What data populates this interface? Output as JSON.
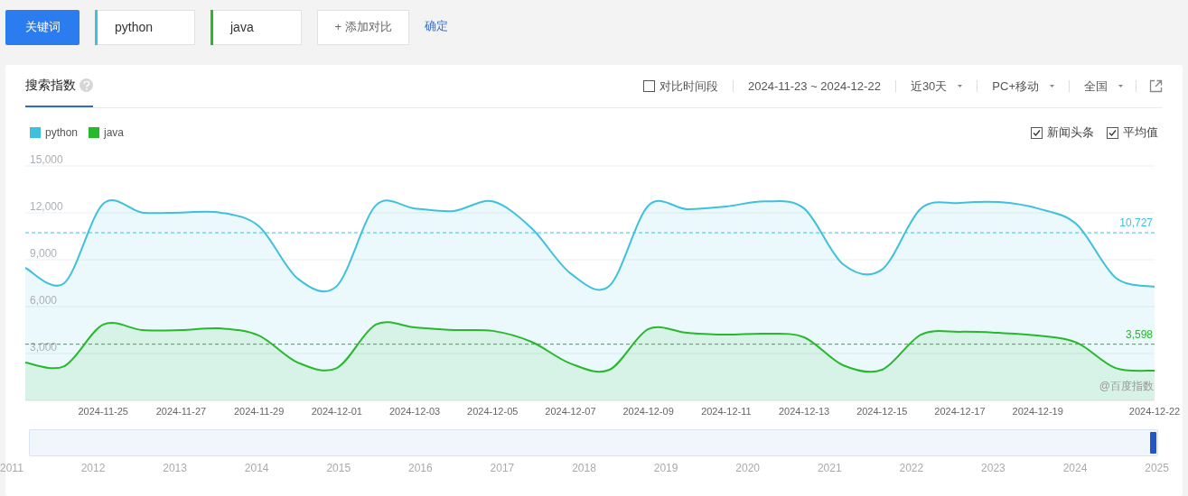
{
  "top_bar": {
    "type_button": "关键词",
    "keywords": [
      {
        "text": "python",
        "color": "#3fc0dd"
      },
      {
        "text": "java",
        "color": "#28b82c"
      }
    ],
    "add_button": "+ 添加对比",
    "confirm_link": "确定"
  },
  "panel": {
    "tabs": [
      {
        "label": "搜索指数",
        "selected": true
      }
    ],
    "compare_period": {
      "label": "对比时间段",
      "checked": false
    },
    "date_range": "2024-11-23 ~ 2024-12-22",
    "dropdowns": [
      {
        "label": "近30天"
      },
      {
        "label": "PC+移动"
      },
      {
        "label": "全国"
      }
    ],
    "options": [
      {
        "label": "新闻头条",
        "checked": true
      },
      {
        "label": "平均值",
        "checked": true
      }
    ],
    "chart_data": {
      "type": "area",
      "x": [
        "2024-11-23",
        "2024-11-24",
        "2024-11-25",
        "2024-11-26",
        "2024-11-27",
        "2024-11-28",
        "2024-11-29",
        "2024-11-30",
        "2024-12-01",
        "2024-12-02",
        "2024-12-03",
        "2024-12-04",
        "2024-12-05",
        "2024-12-06",
        "2024-12-07",
        "2024-12-08",
        "2024-12-09",
        "2024-12-10",
        "2024-12-11",
        "2024-12-12",
        "2024-12-13",
        "2024-12-14",
        "2024-12-15",
        "2024-12-16",
        "2024-12-17",
        "2024-12-18",
        "2024-12-19",
        "2024-12-20",
        "2024-12-21",
        "2024-12-22"
      ],
      "series": [
        {
          "name": "python",
          "color": "#3fc0dd",
          "values": [
            8480,
            7500,
            12580,
            12020,
            12020,
            12020,
            11140,
            7780,
            7320,
            12470,
            12280,
            12120,
            12730,
            11020,
            8130,
            7320,
            12460,
            12230,
            12410,
            12730,
            12280,
            8710,
            8370,
            12280,
            12630,
            12690,
            12280,
            11260,
            7850,
            7270
          ]
        },
        {
          "name": "java",
          "color": "#28b82c",
          "values": [
            2420,
            2190,
            4850,
            4500,
            4500,
            4610,
            4150,
            2420,
            2070,
            4850,
            4670,
            4500,
            4450,
            3750,
            2360,
            1960,
            4560,
            4320,
            4210,
            4270,
            4040,
            2250,
            1960,
            4210,
            4390,
            4320,
            4150,
            3700,
            2070,
            1900
          ]
        }
      ],
      "grid": true,
      "xlim": [
        "2024-11-23",
        "2024-12-22"
      ],
      "ylim": [
        0,
        15000
      ],
      "yticks": [
        {
          "value": 3000,
          "label": "3,000"
        },
        {
          "value": 6000,
          "label": "6,000"
        },
        {
          "value": 9000,
          "label": "9,000"
        },
        {
          "value": 12000,
          "label": "12,000"
        },
        {
          "value": 15000,
          "label": "15,000"
        }
      ],
      "xticks": [
        "2024-11-25",
        "2024-11-27",
        "2024-11-29",
        "2024-12-01",
        "2024-12-03",
        "2024-12-05",
        "2024-12-07",
        "2024-12-09",
        "2024-12-11",
        "2024-12-13",
        "2024-12-15",
        "2024-12-17",
        "2024-12-19",
        "2024-12-22"
      ],
      "ref_lines": [
        {
          "axis": "y",
          "value": 10727,
          "label": "10,727"
        },
        {
          "axis": "y",
          "value": 3598,
          "label": "3,598"
        }
      ]
    },
    "chart_watermark": "@百度指数",
    "range_slider": {
      "level": 1,
      "years": [
        "2011",
        "2012",
        "2013",
        "2014",
        "2015",
        "2016",
        "2017",
        "2018",
        "2019",
        "2020",
        "2021",
        "2022",
        "2023",
        "2024",
        "2025"
      ]
    }
  }
}
